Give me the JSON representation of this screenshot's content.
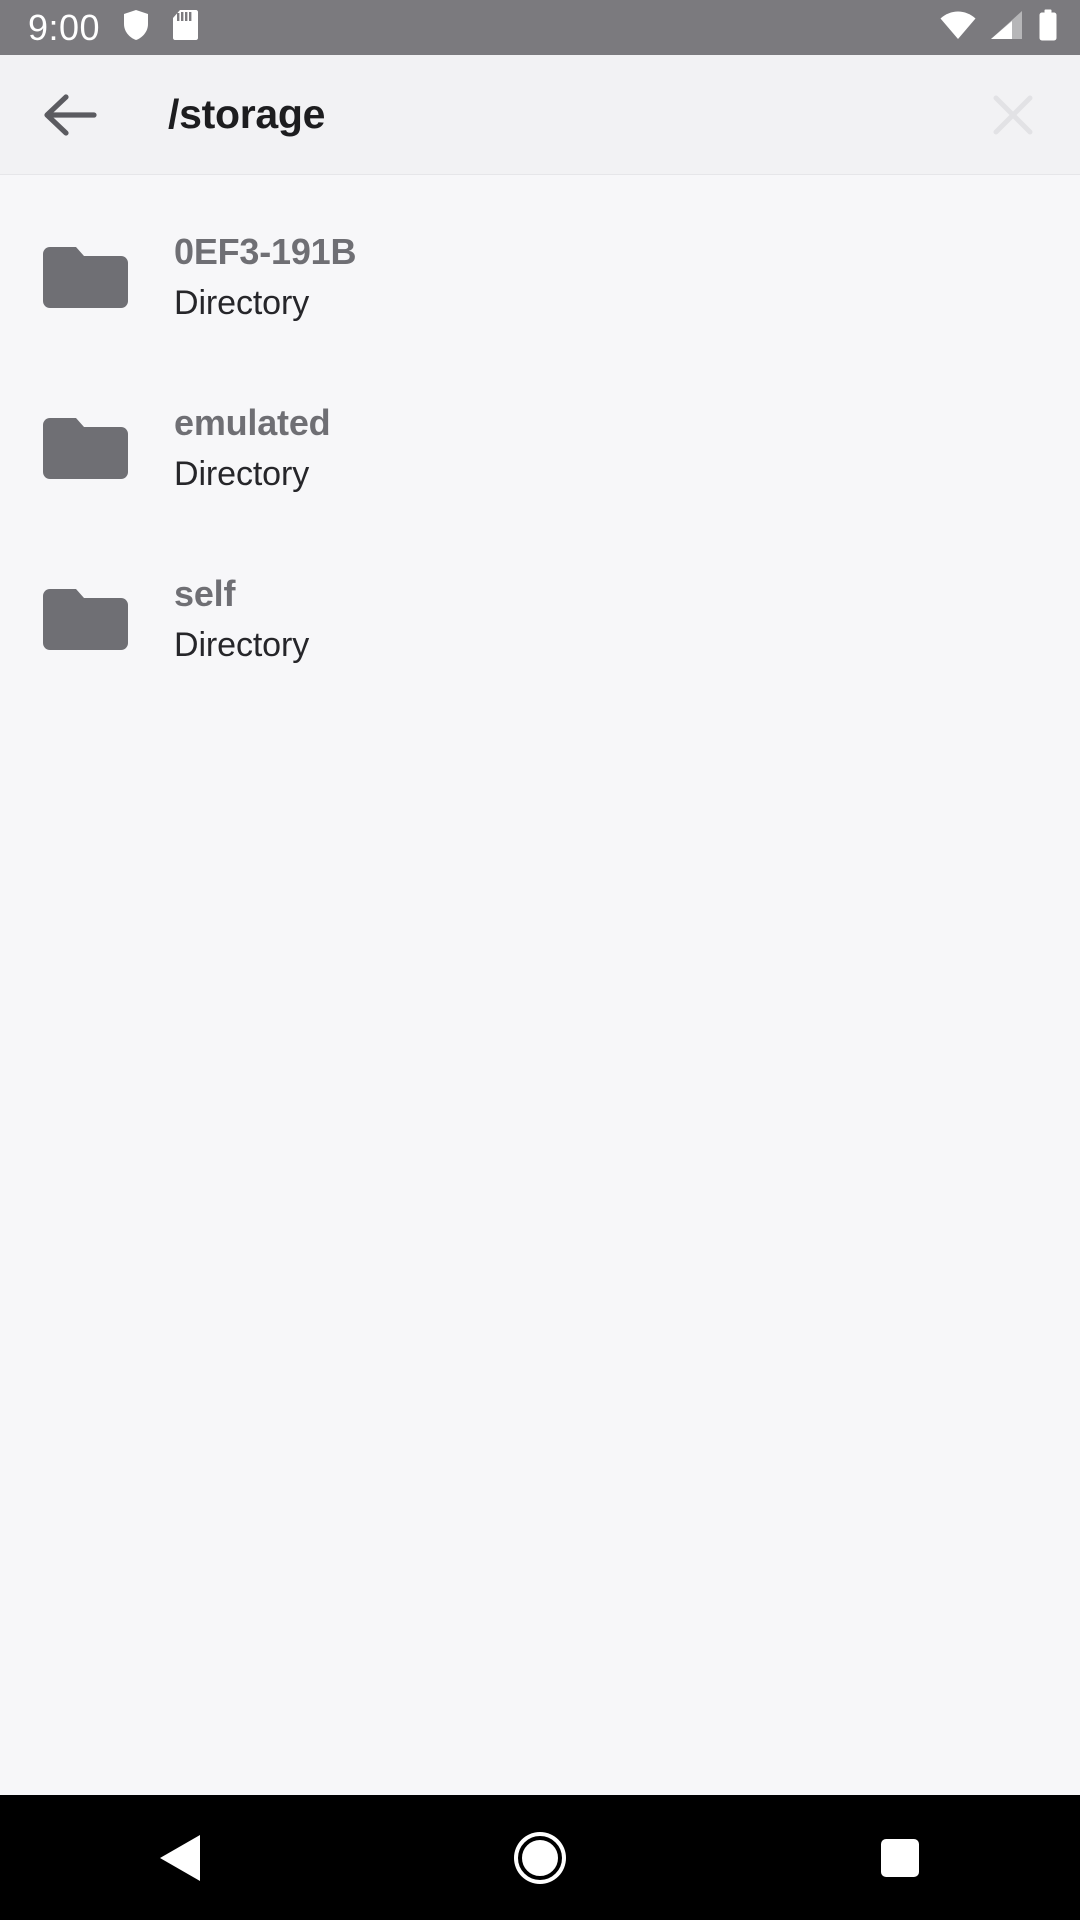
{
  "status_bar": {
    "clock": "9:00",
    "left_icons": [
      "shield-icon",
      "sd-card-icon"
    ],
    "right_icons": [
      "wifi-icon",
      "cellular-signal-icon",
      "battery-icon"
    ],
    "background_color": "#7b7a7e",
    "foreground_color": "#ffffff"
  },
  "toolbar": {
    "back_icon": "arrow-left-icon",
    "title": "/storage",
    "close_icon": "close-x-icon",
    "background_color": "#f2f2f4",
    "title_color": "#1d1d1f",
    "close_icon_color": "#e2e2e5"
  },
  "file_list": {
    "item_subtitle_type": "Directory",
    "folder_icon_color": "#6f6f74",
    "items": [
      {
        "name": "0EF3-191B",
        "subtitle": "Directory",
        "icon": "folder-icon",
        "type": "directory"
      },
      {
        "name": "emulated",
        "subtitle": "Directory",
        "icon": "folder-icon",
        "type": "directory"
      },
      {
        "name": "self",
        "subtitle": "Directory",
        "icon": "folder-icon",
        "type": "directory"
      }
    ]
  },
  "nav_bar": {
    "background_color": "#000000",
    "buttons": [
      {
        "name": "Back",
        "icon": "nav-back-triangle-icon"
      },
      {
        "name": "Home",
        "icon": "nav-home-circle-icon"
      },
      {
        "name": "Recents",
        "icon": "nav-recents-square-icon"
      }
    ]
  }
}
